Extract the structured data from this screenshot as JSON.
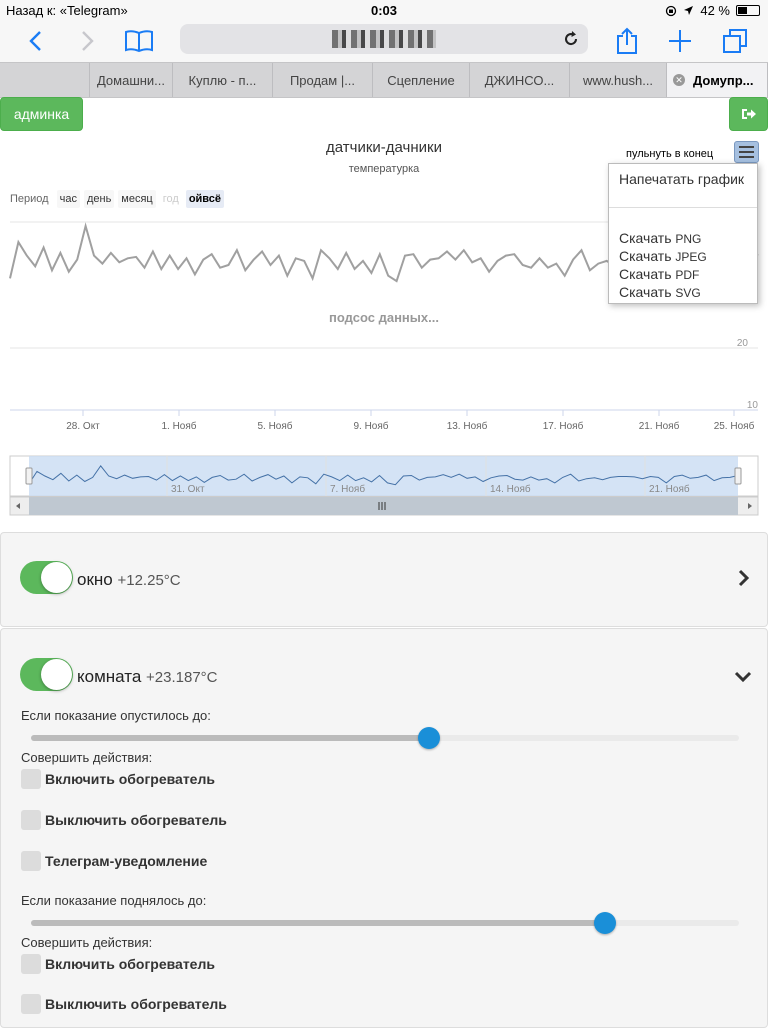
{
  "status_bar": {
    "back_to_app": "Назад к: «Telegram»",
    "time": "0:03",
    "battery": "42 %"
  },
  "tabs": [
    {
      "label": "",
      "active": false
    },
    {
      "label": "Домашни...",
      "active": false
    },
    {
      "label": "Куплю - п...",
      "active": false
    },
    {
      "label": "Продам |...",
      "active": false
    },
    {
      "label": "Сцепление",
      "active": false
    },
    {
      "label": "ДЖИНСО...",
      "active": false
    },
    {
      "label": "www.hush...",
      "active": false
    },
    {
      "label": "Домупр...",
      "active": true
    }
  ],
  "header": {
    "admin_label": "админка"
  },
  "chart": {
    "pull_end_label": "пульнуть в конец",
    "range_label": "Период",
    "range_buttons": [
      {
        "label": "час",
        "state": "normal"
      },
      {
        "label": "день",
        "state": "normal"
      },
      {
        "label": "месяц",
        "state": "normal"
      },
      {
        "label": "год",
        "state": "disabled"
      },
      {
        "label": "ойвсё",
        "state": "selected"
      }
    ],
    "export_menu": {
      "print": "Напечатать график",
      "items": [
        {
          "label": "Скачать",
          "format": "PNG"
        },
        {
          "label": "Скачать",
          "format": "JPEG"
        },
        {
          "label": "Скачать",
          "format": "PDF"
        },
        {
          "label": "Скачать",
          "format": "SVG"
        }
      ]
    }
  },
  "chart_data": {
    "type": "line",
    "title": "датчики-дачники",
    "subtitle": "температурка",
    "loading_text": "подсос данных...",
    "y_ticks": [
      "20",
      "10"
    ],
    "x_ticks": [
      "28. Окт",
      "1. Нояб",
      "5. Нояб",
      "9. Нояб",
      "13. Нояб",
      "17. Нояб",
      "21. Нояб",
      "25. Нояб"
    ],
    "navigator_ticks": [
      "31. Окт",
      "7. Нояб",
      "14. Нояб",
      "21. Нояб"
    ],
    "ylim": [
      10,
      24
    ],
    "series": [
      {
        "color": "#a0a0a0",
        "values": [
          19.8,
          22.5,
          21.5,
          20.7,
          22.1,
          20.4,
          21.7,
          20.3,
          21.2,
          23.7,
          21.5,
          20.9,
          21.7,
          21.0,
          21.3,
          21.4,
          20.6,
          21.8,
          20.5,
          21.5,
          20.5,
          21.3,
          20.1,
          21.2,
          21.6,
          20.6,
          20.8,
          21.9,
          20.4,
          21.2,
          21.8,
          20.8,
          21.5,
          20.0,
          21.3,
          21.1,
          19.8,
          21.9,
          21.3,
          20.5,
          21.7,
          20.5,
          21.1,
          20.2,
          21.6,
          20.0,
          19.6,
          21.5,
          21.6,
          20.6,
          21.2,
          21.3,
          21.8,
          21.2,
          21.9,
          21.0,
          21.3,
          20.3,
          21.1,
          21.5,
          21.6,
          20.8,
          20.6,
          21.3,
          20.6,
          20.9,
          20.0,
          21.2,
          21.9,
          20.4,
          20.9,
          21.1,
          20.7,
          21.2,
          21.4,
          21.4,
          21.3,
          20.9,
          21.4,
          21.2,
          20.0,
          21.4,
          21.7,
          21.0,
          21.2,
          21.7,
          20.5,
          21.1,
          21.2,
          21.6
        ]
      }
    ]
  },
  "sensors": [
    {
      "name": "окно",
      "value": "+12.25°C",
      "expanded": false
    },
    {
      "name": "комната",
      "value": "+23.187°C",
      "expanded": true
    }
  ],
  "rules": [
    {
      "condition_label": "Если показание опустилось до:",
      "slider_level": 0.562,
      "actions_label": "Совершить действия:",
      "actions": [
        "Включить обогреватель",
        "Выключить обогреватель",
        "Телеграм-уведомление"
      ]
    },
    {
      "condition_label": "Если показание поднялось до:",
      "slider_level": 0.811,
      "actions_label": "Совершить действия:",
      "actions": [
        "Включить обогреватель",
        "Выключить обогреватель"
      ]
    }
  ]
}
